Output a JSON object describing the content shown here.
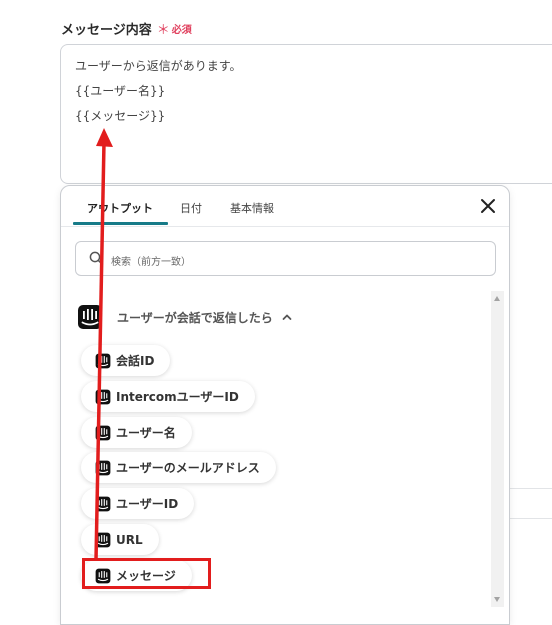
{
  "field": {
    "label": "メッセージ内容",
    "required_star": "＊",
    "required_text": "必須",
    "lines": [
      "ユーザーから返信があります。",
      "{{ユーザー名}}",
      "{{メッセージ}}"
    ]
  },
  "popup": {
    "tabs": [
      {
        "label": "アウトプット",
        "active": true
      },
      {
        "label": "日付",
        "active": false
      },
      {
        "label": "基本情報",
        "active": false
      }
    ],
    "close_icon": "close-icon",
    "search": {
      "placeholder": "検索（前方一致）",
      "icon": "search-icon"
    },
    "section": {
      "label": "ユーザーが会話で返信したら",
      "icon": "intercom-icon",
      "expanded": true
    },
    "items": [
      {
        "label": "会話ID"
      },
      {
        "label": "IntercomユーザーID"
      },
      {
        "label": "ユーザー名"
      },
      {
        "label": "ユーザーのメールアドレス"
      },
      {
        "label": "ユーザーID"
      },
      {
        "label": "URL"
      },
      {
        "label": "メッセージ",
        "highlighted": true
      }
    ]
  },
  "colors": {
    "accent": "#177b88",
    "required": "#e0405e",
    "annotation_red": "#e21d1d"
  }
}
